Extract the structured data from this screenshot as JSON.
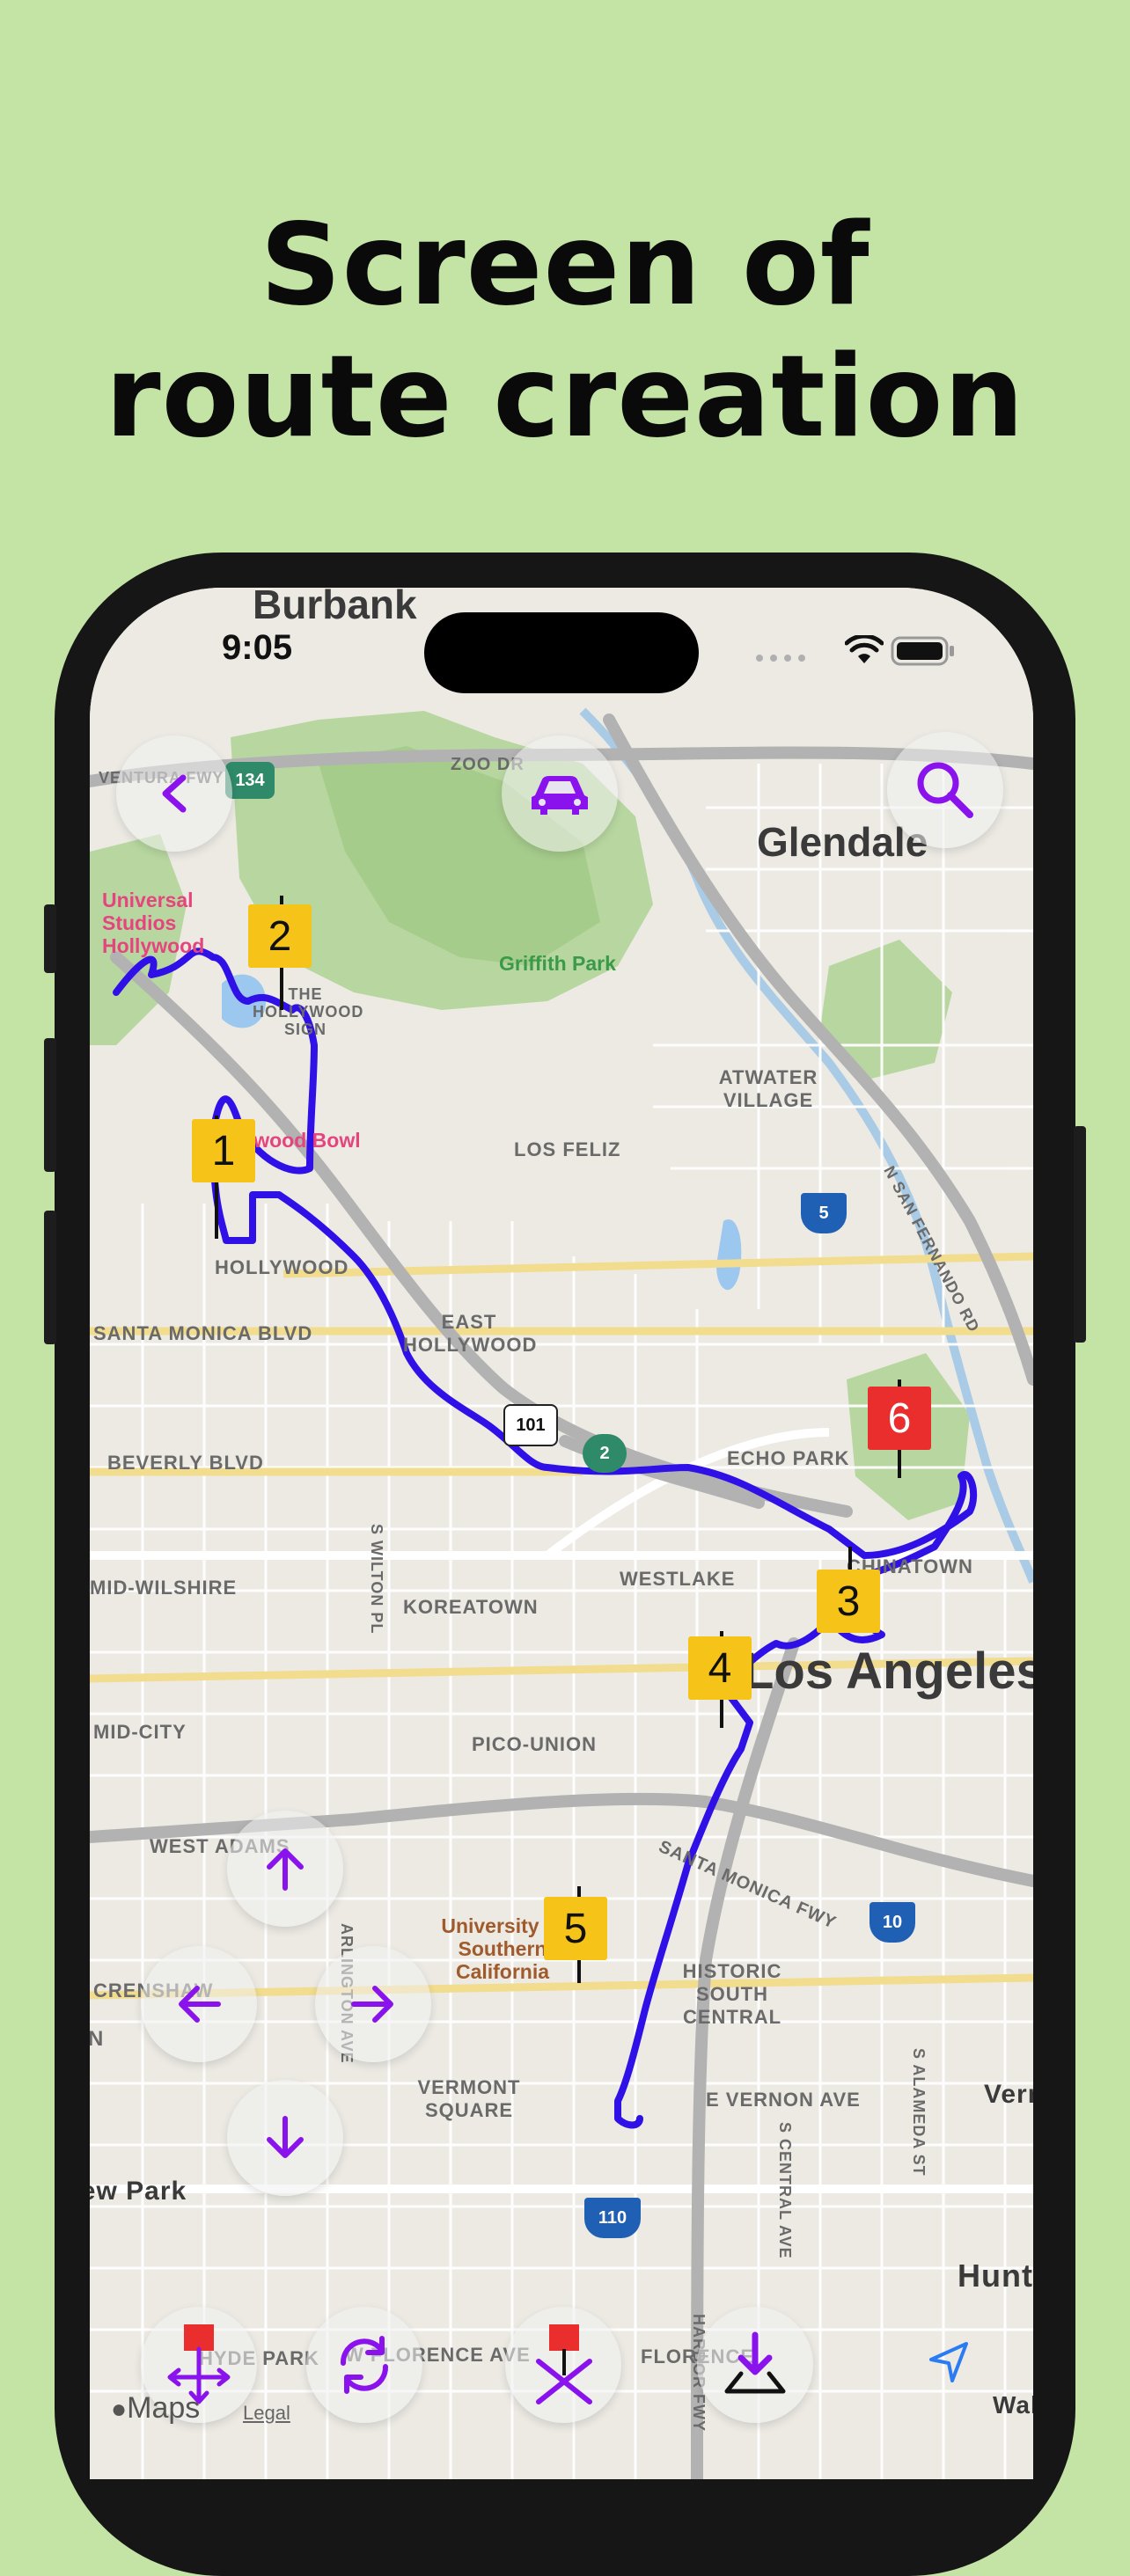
{
  "headline": {
    "line1": "Screen of",
    "line2": "route creation"
  },
  "status_bar": {
    "time": "9:05"
  },
  "map": {
    "labels": {
      "burbank": "Burbank",
      "glendale": "Glendale",
      "griffith_park": "Griffith Park",
      "universal_studios": "Universal Studios Hollywood",
      "hollywood_sign": "THE HOLLYWOOD SIGN",
      "hollywood_bowl": "Hollywood Bowl",
      "atwater_village": "ATWATER VILLAGE",
      "los_feliz": "LOS FELIZ",
      "hollywood": "HOLLYWOOD",
      "east_hollywood": "EAST HOLLYWOOD",
      "santa_monica_blvd": "SANTA MONICA BLVD",
      "beverly_blvd": "BEVERLY BLVD",
      "echo_park": "ECHO PARK",
      "chinatown": "CHINATOWN",
      "westlake": "WESTLAKE",
      "koreatown": "KOREATOWN",
      "mid_wilshire": "MID-WILSHIRE",
      "los_angeles": "Los Angeles",
      "mid_city": "MID-CITY",
      "pico_union": "PICO-UNION",
      "west_adams": "WEST ADAMS",
      "santa_monica_fwy": "SANTA MONICA FWY",
      "usc": "University of Southern California",
      "historic_south_central": "HISTORIC SOUTH CENTRAL",
      "crenshaw": "CRENSHAW",
      "vermont_square": "VERMONT SQUARE",
      "e_vernon_ave": "E VERNON AVE",
      "vernon": "Vernon",
      "view_park": "View Park",
      "hyde_park": "HYDE PARK",
      "w_florence_ave": "W FLORENCE AVE",
      "florence": "FLORENCE",
      "huntington_park": "Huntington Park",
      "walnut_park": "Walnut Park",
      "n_san_fernando_rd": "N SAN FERNANDO RD",
      "s_wilton_pl": "S WILTON PL",
      "arlington_ave": "ARLINGTON AVE",
      "s_central_ave": "S CENTRAL AVE",
      "s_alameda_st": "S ALAMEDA ST",
      "harbor_fwy": "HARBOR FWY",
      "zoo_dr": "ZOO DR",
      "ventura_fwy": "VENTURA FWY",
      "n": "N"
    },
    "shields": {
      "r134": "134",
      "i5": "5",
      "us101": "101",
      "r2": "2",
      "i10": "10",
      "i110": "110"
    },
    "attribution": {
      "maps": "Maps",
      "legal": "Legal"
    }
  },
  "route": {
    "markers": [
      {
        "label": "1",
        "color": "#f6c318"
      },
      {
        "label": "2",
        "color": "#f6c318"
      },
      {
        "label": "3",
        "color": "#f6c318"
      },
      {
        "label": "4",
        "color": "#f6c318"
      },
      {
        "label": "5",
        "color": "#f6c318"
      },
      {
        "label": "6",
        "color": "#ea2e2e"
      }
    ],
    "line_color": "#2f10e6"
  },
  "controls": {
    "accent_color": "#8a12ec",
    "icons": {
      "back": "chevron-left-icon",
      "travel_mode": "car-icon",
      "search": "magnifier-icon",
      "up": "arrow-up-icon",
      "left": "arrow-left-icon",
      "right": "arrow-right-icon",
      "down": "arrow-down-icon",
      "move_flag": "move-flag-icon",
      "refresh": "refresh-icon",
      "delete_flag": "delete-flag-icon",
      "save": "download-tray-icon",
      "location": "location-arrow-icon"
    }
  }
}
